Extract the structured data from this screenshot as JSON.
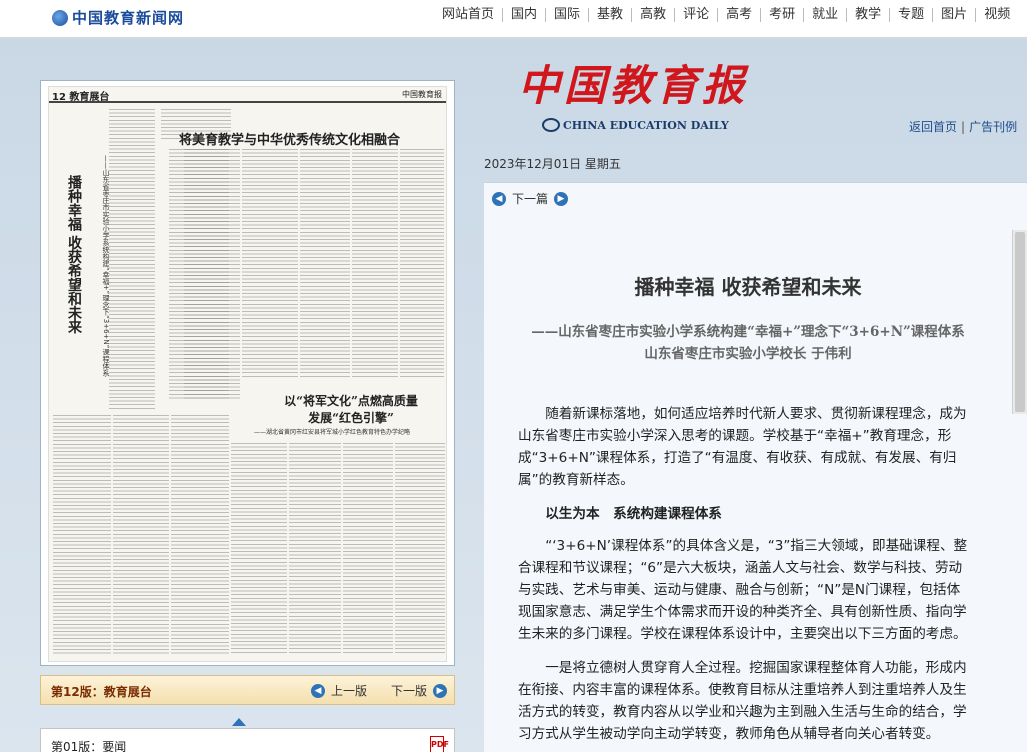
{
  "site": {
    "logo_text": "中国教育新闻网"
  },
  "topnav": [
    "网站首页",
    "国内",
    "国际",
    "基教",
    "高教",
    "评论",
    "高考",
    "考研",
    "就业",
    "教学",
    "专题",
    "图片",
    "视频"
  ],
  "masthead": {
    "cn": "中国教育报",
    "en": "CHINA EDUCATION DAILY"
  },
  "utility": {
    "home": "返回首页",
    "ads": "广告刊例"
  },
  "date": "2023年12月01日  星期五",
  "article_nav": {
    "next_article": "下一篇"
  },
  "article": {
    "title": "播种幸福  收获希望和未来",
    "subtitle1": "——山东省枣庄市实验小学系统构建“幸福+”理念下“3+6+N”课程体系",
    "subtitle2": "山东省枣庄市实验小学校长  于伟利",
    "para1": "随着新课标落地，如何适应培养时代新人要求、贯彻新课程理念，成为山东省枣庄市实验小学深入思考的课题。学校基于“幸福+”教育理念，形成“3+6+N”课程体系，打造了“有温度、有收获、有成就、有发展、有归属”的教育新样态。",
    "section1": "以生为本　系统构建课程体系",
    "para2": "“‘3+6+N’课程体系”的具体含义是，“3”指三大领域，即基础课程、整合课程和节议课程；“6”是六大板块，涵盖人文与社会、数学与科技、劳动与实践、艺术与审美、运动与健康、融合与创新；“N”是N门课程，包括体现国家意志、满足学生个体需求而开设的种类齐全、具有创新性质、指向学生未来的多门课程。学校在课程体系设计中，主要突出以下三方面的考虑。",
    "para3": "一是将立德树人贯穿育人全过程。挖掘国家课程整体育人功能，形成内在衔接、内容丰富的课程体系。使教育目标从注重培养人到注重培养人及生活方式的转变，教育内容从以学业和兴趣为主到融入生活与生命的结合，学习方式从学生被动学向主动学转变，教师角色从辅导者向关心者转变。"
  },
  "newspaper": {
    "page_no": "12 教育展台",
    "paper_name": "中国教育报",
    "headline1": "将美育教学与中华优秀传统文化相融合",
    "vertical_title": "播种幸福  收获希望和未来",
    "vertical_sub": "——山东省枣庄市实验小学系统构建“幸福+”理念下“3+6+N”课程体系",
    "headline2": "以“将军文化”点燃高质量发展“红色引擎”",
    "headline2_sub": "——湖北省黄冈市红安县将军城小学红色教育特色办学纪略"
  },
  "thumb_bar": {
    "page_label": "第12版：教育展台",
    "prev": "上一版",
    "next": "下一版"
  },
  "page_list": {
    "item": "第01版：要闻"
  }
}
